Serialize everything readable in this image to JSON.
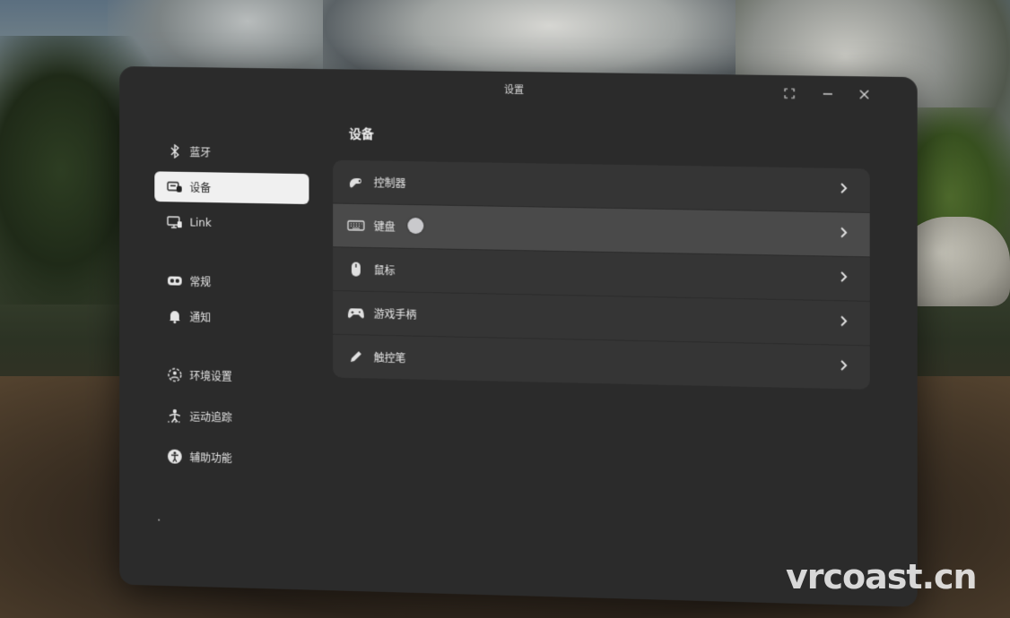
{
  "window": {
    "title": "设置"
  },
  "sidebar": {
    "items": [
      {
        "label": "蓝牙",
        "icon": "bluetooth-icon",
        "active": false
      },
      {
        "label": "设备",
        "icon": "devices-icon",
        "active": true
      },
      {
        "label": "Link",
        "icon": "link-monitor-icon",
        "active": false
      },
      {
        "label": "常规",
        "icon": "headset-icon",
        "active": false
      },
      {
        "label": "通知",
        "icon": "bell-icon",
        "active": false
      },
      {
        "label": "环境设置",
        "icon": "environment-icon",
        "active": false
      },
      {
        "label": "运动追踪",
        "icon": "movement-tracking-icon",
        "active": false
      },
      {
        "label": "辅助功能",
        "icon": "accessibility-icon",
        "active": false
      }
    ]
  },
  "main": {
    "title": "设备",
    "rows": [
      {
        "label": "控制器",
        "icon": "controller-icon"
      },
      {
        "label": "键盘",
        "icon": "keyboard-icon"
      },
      {
        "label": "鼠标",
        "icon": "mouse-icon"
      },
      {
        "label": "游戏手柄",
        "icon": "gamepad-icon"
      },
      {
        "label": "触控笔",
        "icon": "stylus-icon"
      }
    ]
  },
  "watermark": "vrcoast.cn",
  "colors": {
    "window_bg": "#2b2b2b",
    "list_bg": "#353535",
    "active_item_bg": "#f0f0f0",
    "hover_row_bg": "#4a4a4a"
  }
}
